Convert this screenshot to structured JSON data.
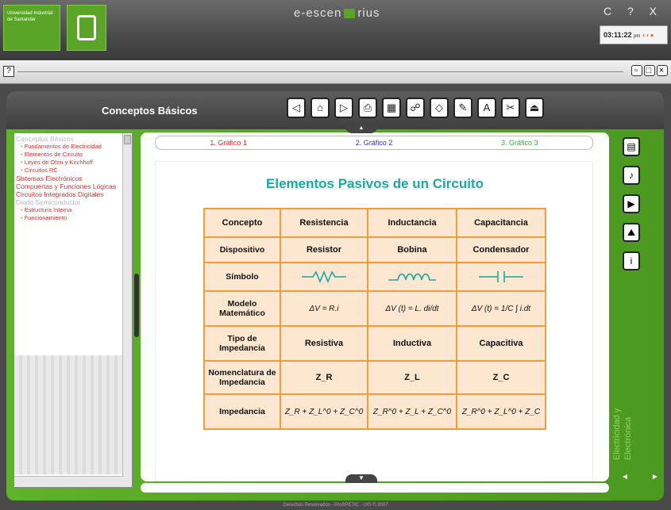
{
  "header": {
    "university_name": "Universidad Industrial de Santander",
    "brand_left": "e-escen",
    "brand_right": "rius",
    "window_controls": "C ? X",
    "clock_time": "03:11:22",
    "clock_ampm": "pm"
  },
  "subbar": {
    "help_label": "?"
  },
  "toolbar": {
    "section_title": "Conceptos Básicos",
    "buttons": [
      "prev-icon",
      "home-icon",
      "next-icon",
      "print-icon",
      "calculator-icon",
      "people-icon",
      "eraser-icon",
      "image-icon",
      "font-icon",
      "tools-icon",
      "exit-icon"
    ]
  },
  "nav": {
    "items": [
      {
        "label": "Conceptos Básicos",
        "type": "head",
        "state": "dim"
      },
      {
        "label": "Fundamentos de Electricidad",
        "type": "sub"
      },
      {
        "label": "Elementos de Circuito",
        "type": "sub"
      },
      {
        "label": "Leyes de Ohm y Kirchhoff",
        "type": "sub"
      },
      {
        "label": "Circuitos RC",
        "type": "sub"
      },
      {
        "label": "Sistemas Electrónicos",
        "type": "head"
      },
      {
        "label": "Compuertas y Funciones Lógicas",
        "type": "head"
      },
      {
        "label": "Circuitos Integrados Digitales",
        "type": "head"
      },
      {
        "label": "Diodo Semiconductor",
        "type": "head",
        "state": "dim"
      },
      {
        "label": "Estructura Interna",
        "type": "sub"
      },
      {
        "label": "Funcionamiento",
        "type": "sub"
      }
    ]
  },
  "tabs": [
    "1. Gráfico 1",
    "2. Gráfico 2",
    "3. Gráfico 3"
  ],
  "slide": {
    "title": "Elementos Pasivos de un Circuito",
    "table": {
      "headers": [
        "Concepto",
        "Resistencia",
        "Inductancia",
        "Capacitancia"
      ],
      "rows": [
        {
          "label": "Dispositivo",
          "values": [
            "Resistor",
            "Bobina",
            "Condensador"
          ]
        },
        {
          "label": "Símbolo",
          "values": [
            "resistor-symbol",
            "inductor-symbol",
            "capacitor-symbol"
          ]
        },
        {
          "label": "Modelo Matemático",
          "values": [
            "ΔV = R.i",
            "ΔV (t) = L. di/dt",
            "ΔV (t) = 1/C ∫ i.dt"
          ]
        },
        {
          "label": "Tipo de Impedancia",
          "values": [
            "Resistiva",
            "Inductiva",
            "Capacitiva"
          ]
        },
        {
          "label": "Nomenclatura de Impedancia",
          "values": [
            "Z_R",
            "Z_L",
            "Z_C"
          ]
        },
        {
          "label": "Impedancia",
          "values": [
            "Z_R + Z_L^0 + Z_C^0",
            "Z_R^0 + Z_L + Z_C^0",
            "Z_R^0 + Z_L^0 + Z_C"
          ]
        }
      ]
    }
  },
  "right_panel": {
    "buttons": [
      "document-icon",
      "audio-icon",
      "video-icon",
      "image-icon",
      "info-icon"
    ],
    "vertical_label": "Electricidad y Electrónica"
  },
  "footer": "Derechos Reservados - ProSPETIC - UIS © 2007",
  "colors": {
    "green": "#5aa528",
    "table_border": "#f39a3c",
    "table_fill": "#fde7d0",
    "title_teal": "#1aa9a2"
  }
}
